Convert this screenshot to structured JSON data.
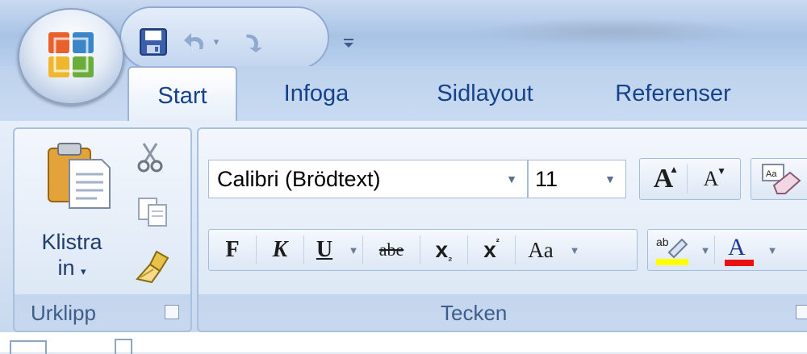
{
  "qat": {
    "save_icon": "save-icon",
    "undo_icon": "undo-icon",
    "redo_icon": "redo-icon",
    "customize_icon": "customize-qat-icon"
  },
  "tabs": [
    {
      "label": "Start",
      "active": true
    },
    {
      "label": "Infoga"
    },
    {
      "label": "Sidlayout"
    },
    {
      "label": "Referenser"
    }
  ],
  "clipboard": {
    "paste_label_line1": "Klistra",
    "paste_label_line2": "in",
    "group_label": "Urklipp"
  },
  "font": {
    "font_name": "Calibri (Brödtext)",
    "font_size": "11",
    "group_label": "Tecken",
    "bold": "F",
    "italic": "K",
    "underline": "U",
    "strike": "abe",
    "subscript": "x",
    "superscript": "x",
    "change_case": "Aa",
    "grow": "A",
    "shrink": "A",
    "highlight": "ab",
    "font_color": "A"
  },
  "colors": {
    "accent_text": "#15428b",
    "highlight_yellow": "#ffff00",
    "font_red": "#e81010"
  }
}
